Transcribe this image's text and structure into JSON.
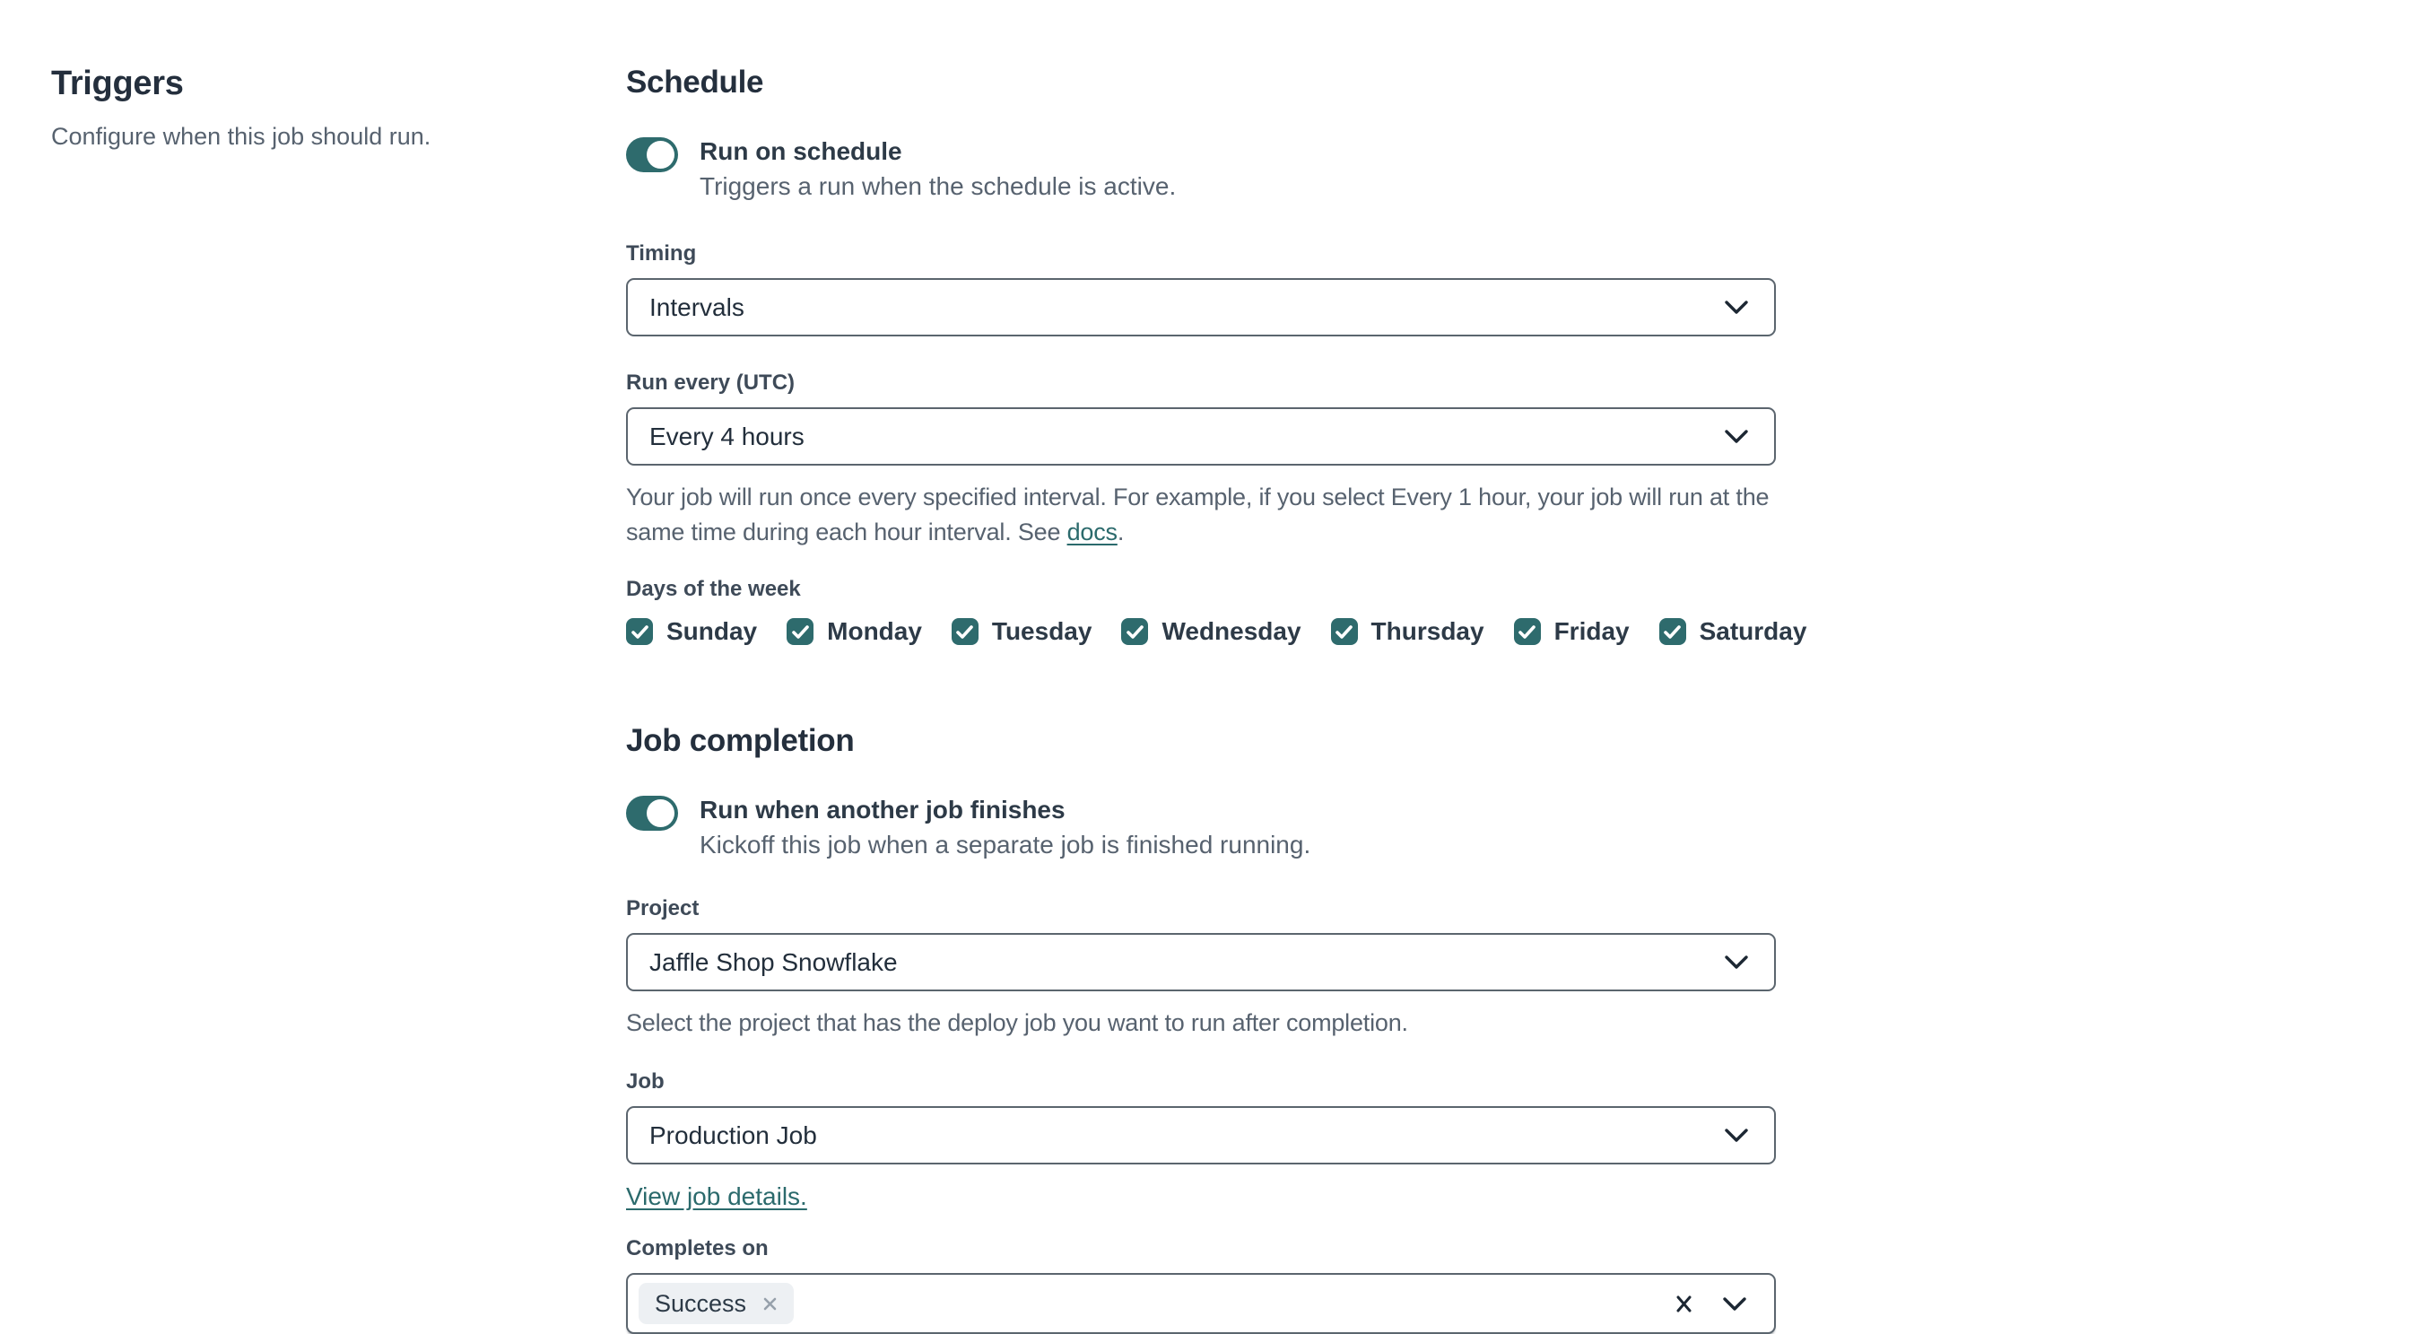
{
  "page": {
    "title": "Triggers",
    "subtitle": "Configure when this job should run."
  },
  "schedule": {
    "heading": "Schedule",
    "toggle": {
      "state": "on",
      "label": "Run on schedule",
      "description": "Triggers a run when the schedule is active."
    },
    "timing": {
      "label": "Timing",
      "value": "Intervals"
    },
    "run_every": {
      "label": "Run every (UTC)",
      "value": "Every 4 hours",
      "help_before": "Your job will run once every specified interval. For example, if you select Every 1 hour, your job will run at the same time during each hour interval. See ",
      "help_link": "docs",
      "help_after": "."
    },
    "days_of_week": {
      "label": "Days of the week",
      "days": [
        {
          "label": "Sunday",
          "checked": true
        },
        {
          "label": "Monday",
          "checked": true
        },
        {
          "label": "Tuesday",
          "checked": true
        },
        {
          "label": "Wednesday",
          "checked": true
        },
        {
          "label": "Thursday",
          "checked": true
        },
        {
          "label": "Friday",
          "checked": true
        },
        {
          "label": "Saturday",
          "checked": true
        }
      ]
    }
  },
  "job_completion": {
    "heading": "Job completion",
    "toggle": {
      "state": "on",
      "label": "Run when another job finishes",
      "description": "Kickoff this job when a separate job is finished running."
    },
    "project": {
      "label": "Project",
      "value": "Jaffle Shop Snowflake",
      "help": "Select the project that has the deploy job you want to run after completion."
    },
    "job": {
      "label": "Job",
      "value": "Production Job",
      "link": "View job details."
    },
    "completes_on": {
      "label": "Completes on",
      "tags": [
        {
          "label": "Success"
        }
      ]
    }
  },
  "colors": {
    "accent_teal": "#2e6b6d",
    "link_teal": "#2b6a6c",
    "heading": "#242f3d",
    "muted_text": "#57626f",
    "border": "#5b656e",
    "tag_background": "#edf0f3"
  }
}
